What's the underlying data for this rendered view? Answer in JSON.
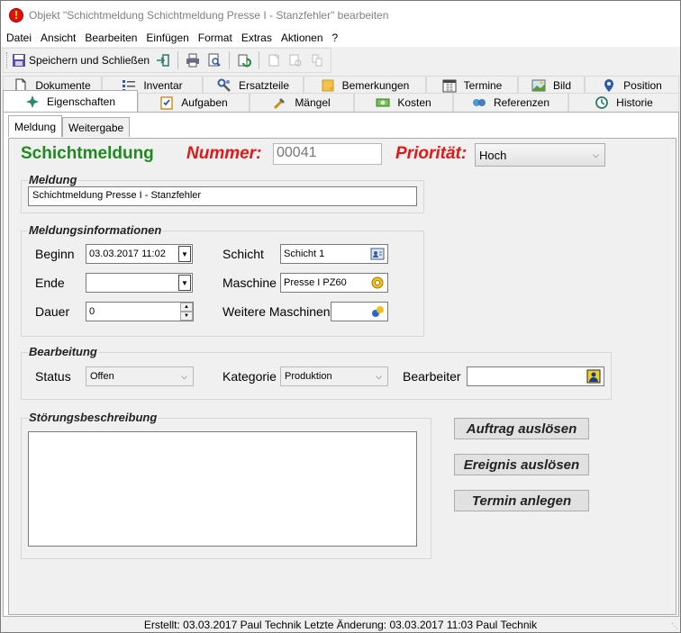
{
  "window": {
    "title": "Objekt \"Schichtmeldung Schichtmeldung Presse I - Stanzfehler\" bearbeiten"
  },
  "menu": {
    "datei": "Datei",
    "ansicht": "Ansicht",
    "bearbeiten": "Bearbeiten",
    "einfuegen": "Einfügen",
    "format": "Format",
    "extras": "Extras",
    "aktionen": "Aktionen",
    "help": "?"
  },
  "toolbar": {
    "save_close": "Speichern und Schließen"
  },
  "tabs": {
    "row1": [
      "Dokumente",
      "Inventar",
      "Ersatzteile",
      "Bemerkungen",
      "Termine",
      "Bild",
      "Position"
    ],
    "row2": [
      "Eigenschaften",
      "Aufgaben",
      "Mängel",
      "Kosten",
      "Referenzen",
      "Historie"
    ],
    "active": "Eigenschaften"
  },
  "subtabs": [
    "Meldung",
    "Weitergabe"
  ],
  "header": {
    "title": "Schichtmeldung",
    "nummer_label": "Nummer:",
    "nummer_value": "00041",
    "prioritaet_label": "Priorität:",
    "prioritaet_value": "Hoch"
  },
  "meldung": {
    "group_title": "Meldung",
    "value": "Schichtmeldung Presse I - Stanzfehler"
  },
  "info": {
    "group_title": "Meldungsinformationen",
    "beginn_label": "Beginn",
    "beginn_value": "03.03.2017 11:02",
    "ende_label": "Ende",
    "ende_value": "",
    "dauer_label": "Dauer",
    "dauer_value": "0",
    "schicht_label": "Schicht",
    "schicht_value": "Schicht 1",
    "maschine_label": "Maschine",
    "maschine_value": "Presse I PZ60",
    "weitere_label": "Weitere Maschinen",
    "weitere_value": ""
  },
  "bearbeitung": {
    "group_title": "Bearbeitung",
    "status_label": "Status",
    "status_value": "Offen",
    "kategorie_label": "Kategorie",
    "kategorie_value": "Produktion",
    "bearbeiter_label": "Bearbeiter",
    "bearbeiter_value": ""
  },
  "stoerung": {
    "group_title": "Störungsbeschreibung",
    "value": ""
  },
  "actions": {
    "auftrag": "Auftrag auslösen",
    "ereignis": "Ereignis auslösen",
    "termin": "Termin anlegen"
  },
  "status_bar": {
    "text": "Erstellt: 03.03.2017 Paul Technik  Letzte Änderung: 03.03.2017 11:03 Paul Technik"
  },
  "colors": {
    "title_green": "#1e8a1e",
    "label_red": "#e01818"
  }
}
